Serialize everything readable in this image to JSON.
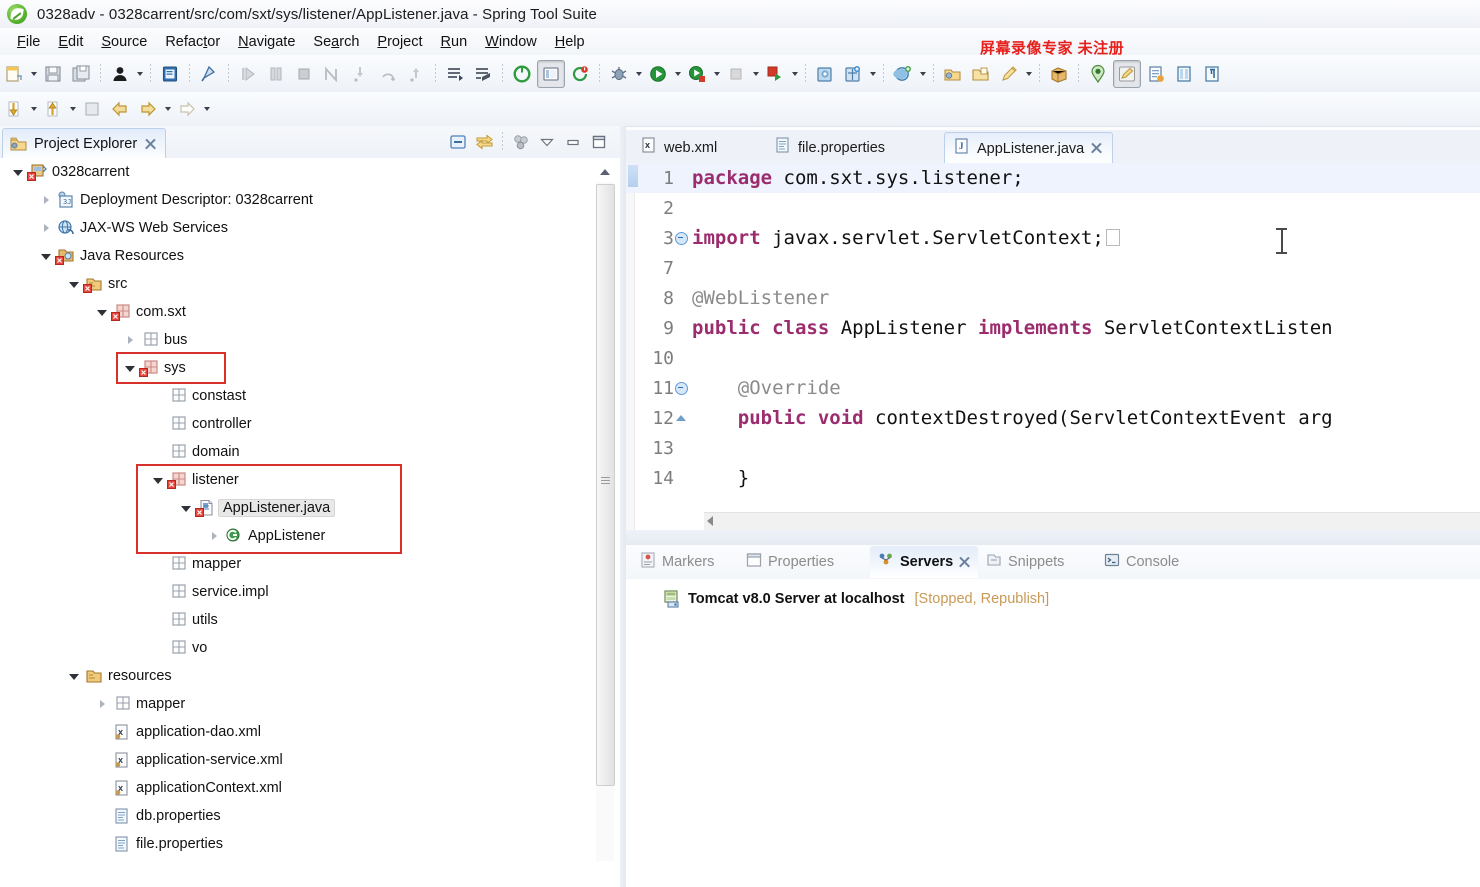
{
  "window": {
    "title": "0328adv - 0328carrent/src/com/sxt/sys/listener/AppListener.java - Spring Tool Suite",
    "logo_icon": "spring-leaf-icon"
  },
  "menubar": {
    "items": [
      {
        "label": "File",
        "mnemonic": "F"
      },
      {
        "label": "Edit",
        "mnemonic": "E"
      },
      {
        "label": "Source",
        "mnemonic": "S"
      },
      {
        "label": "Refactor",
        "mnemonic": "t"
      },
      {
        "label": "Navigate",
        "mnemonic": "N"
      },
      {
        "label": "Search",
        "mnemonic": "a"
      },
      {
        "label": "Project",
        "mnemonic": "P"
      },
      {
        "label": "Run",
        "mnemonic": "R"
      },
      {
        "label": "Window",
        "mnemonic": "W"
      },
      {
        "label": "Help",
        "mnemonic": "H"
      }
    ]
  },
  "watermark": {
    "text": "屏幕录像专家  未注册",
    "color": "#e8201c"
  },
  "toolbar": {
    "row1": [
      {
        "icon": "new-wizard-icon",
        "dropdown": true
      },
      {
        "icon": "save-icon",
        "dropdown": false
      },
      {
        "icon": "save-all-icon",
        "dropdown": false
      },
      {
        "sep": true
      },
      {
        "icon": "user-profile-icon",
        "dropdown": true
      },
      {
        "sep": true
      },
      {
        "icon": "print-preview-icon",
        "dropdown": false
      },
      {
        "sep": true
      },
      {
        "icon": "quick-access-pin-icon",
        "dropdown": false
      },
      {
        "sep": true
      },
      {
        "icon": "resume-icon",
        "dropdown": false
      },
      {
        "icon": "suspend-icon",
        "dropdown": false
      },
      {
        "icon": "terminate-icon",
        "dropdown": false
      },
      {
        "icon": "disconnect-icon",
        "dropdown": false
      },
      {
        "icon": "step-into-icon",
        "dropdown": false
      },
      {
        "icon": "step-over-icon",
        "dropdown": false
      },
      {
        "icon": "step-return-icon",
        "dropdown": false
      },
      {
        "sep": true
      },
      {
        "icon": "open-declaration-icon",
        "dropdown": false
      },
      {
        "icon": "open-type-icon",
        "dropdown": false
      },
      {
        "sep": true
      },
      {
        "icon": "spring-boot-icon",
        "dropdown": false
      },
      {
        "icon": "toggle-view-icon",
        "dropdown": false,
        "pressed": true
      },
      {
        "icon": "refresh-cycle-icon",
        "dropdown": false
      },
      {
        "sep": true
      },
      {
        "icon": "debug-icon",
        "dropdown": true
      },
      {
        "icon": "run-icon",
        "dropdown": true
      },
      {
        "icon": "run-external-icon",
        "dropdown": true
      },
      {
        "icon": "stop-icon",
        "dropdown": true
      },
      {
        "icon": "run-server-icon",
        "dropdown": true
      },
      {
        "sep": true
      },
      {
        "icon": "new-java-project-icon",
        "dropdown": false
      },
      {
        "icon": "new-package-icon",
        "dropdown": true
      },
      {
        "sep": true
      },
      {
        "icon": "search-type-icon",
        "dropdown": true
      },
      {
        "sep": true
      },
      {
        "icon": "open-folder-icon",
        "dropdown": false
      },
      {
        "icon": "open-resource-icon",
        "dropdown": false
      },
      {
        "icon": "pencil-edit-icon",
        "dropdown": true
      },
      {
        "sep": true
      },
      {
        "icon": "package-export-icon",
        "dropdown": false
      },
      {
        "sep": true
      },
      {
        "icon": "pin-marker-icon",
        "dropdown": false
      },
      {
        "icon": "highlight-pen-icon",
        "dropdown": false,
        "pressed": true
      },
      {
        "icon": "new-document-icon",
        "dropdown": false
      },
      {
        "icon": "book-view-icon",
        "dropdown": false
      },
      {
        "icon": "paragraph-icon",
        "dropdown": false
      }
    ],
    "row2": [
      {
        "icon": "step-down-icon",
        "dropdown": true
      },
      {
        "icon": "step-up-icon",
        "dropdown": true
      },
      {
        "sep": false
      },
      {
        "icon": "back-arrow-icon",
        "dropdown": false
      },
      {
        "icon": "forward-arrow-icon",
        "dropdown": true
      },
      {
        "icon": "next-arrow-icon",
        "dropdown": true
      }
    ]
  },
  "project_explorer": {
    "tab_label": "Project Explorer",
    "tab_icon": "project-explorer-icon",
    "close_icon": "close-icon",
    "tools": [
      {
        "icon": "collapse-all-icon"
      },
      {
        "icon": "link-with-editor-icon"
      },
      {
        "icon": "view-menu-icon"
      },
      {
        "icon": "chevron-down-icon"
      },
      {
        "icon": "minimize-icon"
      },
      {
        "icon": "maximize-icon"
      }
    ],
    "tree": [
      {
        "label": "0328carrent",
        "indent": 0,
        "twist": "open",
        "icon": "project-icon"
      },
      {
        "label": "Deployment Descriptor: 0328carrent",
        "indent": 1,
        "twist": "closed",
        "icon": "deployment-descriptor-icon"
      },
      {
        "label": "JAX-WS Web Services",
        "indent": 1,
        "twist": "closed",
        "icon": "web-services-icon"
      },
      {
        "label": "Java Resources",
        "indent": 1,
        "twist": "open",
        "icon": "java-resources-icon"
      },
      {
        "label": "src",
        "indent": 2,
        "twist": "open",
        "icon": "source-folder-icon"
      },
      {
        "label": "com.sxt",
        "indent": 3,
        "twist": "open",
        "icon": "package-error-icon"
      },
      {
        "label": "bus",
        "indent": 4,
        "twist": "closed",
        "icon": "package-icon"
      },
      {
        "label": "sys",
        "indent": 4,
        "twist": "open",
        "icon": "package-error-icon"
      },
      {
        "label": "constast",
        "indent": 5,
        "twist": "none",
        "icon": "package-empty-icon"
      },
      {
        "label": "controller",
        "indent": 5,
        "twist": "none",
        "icon": "package-empty-icon"
      },
      {
        "label": "domain",
        "indent": 5,
        "twist": "none",
        "icon": "package-empty-icon"
      },
      {
        "label": "listener",
        "indent": 5,
        "twist": "open",
        "icon": "package-error-icon"
      },
      {
        "label": "AppListener.java",
        "indent": 6,
        "twist": "open",
        "icon": "java-file-error-icon",
        "selected": true
      },
      {
        "label": "AppListener",
        "indent": 7,
        "twist": "closed",
        "icon": "java-class-icon"
      },
      {
        "label": "mapper",
        "indent": 5,
        "twist": "none",
        "icon": "package-empty-icon"
      },
      {
        "label": "service.impl",
        "indent": 5,
        "twist": "none",
        "icon": "package-empty-icon"
      },
      {
        "label": "utils",
        "indent": 5,
        "twist": "none",
        "icon": "package-empty-icon"
      },
      {
        "label": "vo",
        "indent": 5,
        "twist": "none",
        "icon": "package-empty-icon"
      },
      {
        "label": "resources",
        "indent": 2,
        "twist": "open",
        "icon": "source-folder-plain-icon"
      },
      {
        "label": "mapper",
        "indent": 3,
        "twist": "closed",
        "icon": "package-empty-icon"
      },
      {
        "label": "application-dao.xml",
        "indent": 3,
        "twist": "none",
        "icon": "xml-file-icon"
      },
      {
        "label": "application-service.xml",
        "indent": 3,
        "twist": "none",
        "icon": "xml-file-icon"
      },
      {
        "label": "applicationContext.xml",
        "indent": 3,
        "twist": "none",
        "icon": "xml-file-icon"
      },
      {
        "label": "db.properties",
        "indent": 3,
        "twist": "none",
        "icon": "properties-file-icon"
      },
      {
        "label": "file.properties",
        "indent": 3,
        "twist": "none",
        "icon": "properties-file-icon"
      }
    ],
    "highlight_color": "#d9302a"
  },
  "editor": {
    "tabs": [
      {
        "label": "web.xml",
        "icon": "xml-file-icon",
        "active": false
      },
      {
        "label": "file.properties",
        "icon": "properties-file-icon",
        "active": false
      },
      {
        "label": "AppListener.java",
        "icon": "java-file-icon",
        "active": true,
        "close_icon": "close-icon"
      }
    ],
    "lines": [
      {
        "num": "1",
        "fold": "none",
        "kw": "package",
        "rest": " com.sxt.sys.listener;",
        "highlight": true
      },
      {
        "num": "2",
        "fold": "none",
        "kw": "",
        "rest": ""
      },
      {
        "num": "3",
        "fold": "collapsed",
        "kw": "import",
        "rest": " javax.servlet.ServletContext;",
        "box": true
      },
      {
        "num": "7",
        "fold": "none",
        "kw": "",
        "rest": ""
      },
      {
        "num": "8",
        "fold": "none",
        "kw": "",
        "rest": "@WebListener",
        "annotation": true
      },
      {
        "num": "9",
        "fold": "none",
        "kw": "public class",
        "rest": " AppListener ",
        "kw2": "implements",
        "rest2": " ServletContextListen"
      },
      {
        "num": "10",
        "fold": "none",
        "kw": "",
        "rest": ""
      },
      {
        "num": "11",
        "fold": "expanded",
        "kw": "",
        "rest": "    @Override",
        "annotation": true
      },
      {
        "num": "12",
        "fold": "marker",
        "kw": "    public void",
        "rest": " contextDestroyed(ServletContextEvent arg"
      },
      {
        "num": "13",
        "fold": "none",
        "kw": "",
        "rest": ""
      },
      {
        "num": "14",
        "fold": "none",
        "kw": "",
        "rest": "    }"
      }
    ],
    "cursor_icon": "text-ibeam-cursor"
  },
  "bottom_panel": {
    "tabs": [
      {
        "label": "Markers",
        "icon": "markers-icon",
        "active": false
      },
      {
        "label": "Properties",
        "icon": "properties-icon",
        "active": false
      },
      {
        "label": "Servers",
        "icon": "servers-icon",
        "active": true,
        "close_icon": "close-icon"
      },
      {
        "label": "Snippets",
        "icon": "snippets-icon",
        "active": false
      },
      {
        "label": "Console",
        "icon": "console-icon",
        "active": false
      }
    ],
    "server": {
      "icon": "tomcat-server-icon",
      "name": "Tomcat v8.0 Server at localhost",
      "status": "[Stopped, Republish]",
      "status_color": "#c89a55"
    }
  }
}
